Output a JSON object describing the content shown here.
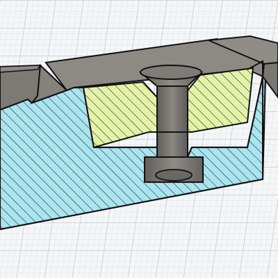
{
  "viewport": {
    "background": "#f4f6f8",
    "grid_minor_color": "#d6dce2",
    "grid_major_color": "#b9c2cb"
  },
  "model": {
    "description_icon": "cross-section-view",
    "section_hatch_colors": {
      "base_body": "#a9e4ef",
      "pocket_insert": "#e4f2a8",
      "hatch_line": "#1a1a1a"
    },
    "surface_colors": {
      "top_face": "#8d8a83",
      "bevel_face": "#7b7872",
      "bolt": "#6f6d69",
      "bolt_head": "#7a7873",
      "outline": "#111111"
    }
  }
}
